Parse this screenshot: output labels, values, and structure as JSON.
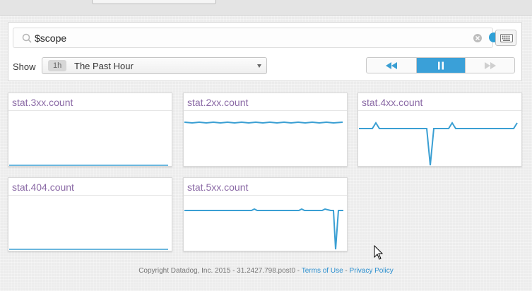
{
  "search": {
    "value": "$scope"
  },
  "toolbar": {
    "show_label": "Show",
    "timeframe_badge": "1h",
    "timeframe_label": "The Past Hour",
    "playback": [
      "rewind",
      "pause",
      "fast-forward"
    ]
  },
  "widgets": [
    {
      "title": "stat.3xx.count"
    },
    {
      "title": "stat.2xx.count"
    },
    {
      "title": "stat.4xx.count"
    },
    {
      "title": "stat.404.count"
    },
    {
      "title": "stat.5xx.count"
    }
  ],
  "footer": {
    "copyright": "Copyright Datadog, Inc. 2015 - 31.2427.798.post0 - ",
    "terms_label": "Terms of Use",
    "separator": " - ",
    "privacy_label": "Privacy Policy"
  },
  "colors": {
    "series": "#3a9fd3",
    "title": "#8b6aa6",
    "accent": "#3aa0d8"
  }
}
